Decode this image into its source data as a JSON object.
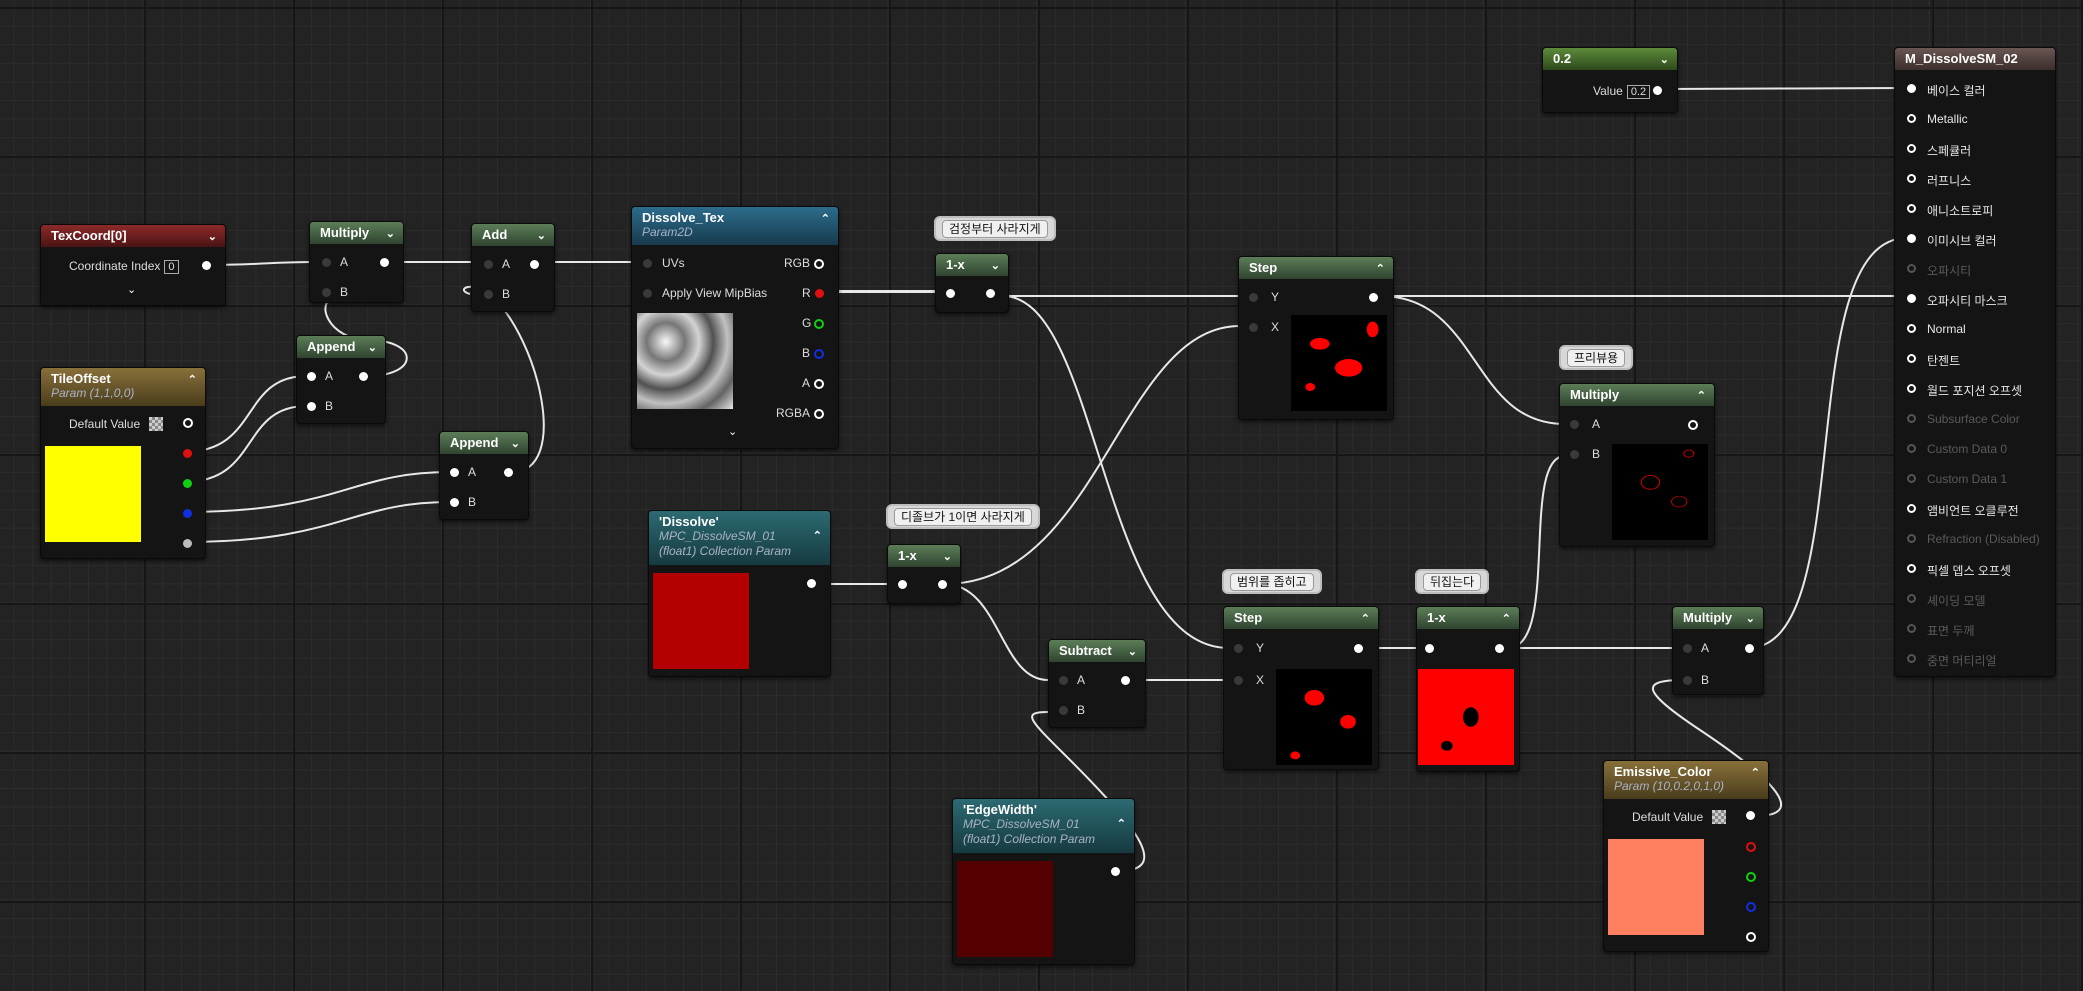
{
  "nodes": {
    "texcoord": {
      "title": "TexCoord[0]",
      "coord_label": "Coordinate Index",
      "coord_value": "0"
    },
    "tileoffset": {
      "title": "TileOffset",
      "subtitle": "Param (1,1,0,0)",
      "default_label": "Default Value",
      "swatch_color": "#ffff00"
    },
    "multiply1": {
      "title": "Multiply",
      "a": "A",
      "b": "B"
    },
    "append1": {
      "title": "Append",
      "a": "A",
      "b": "B"
    },
    "add": {
      "title": "Add",
      "a": "A",
      "b": "B"
    },
    "append2": {
      "title": "Append",
      "a": "A",
      "b": "B"
    },
    "dissolve_tex": {
      "title": "Dissolve_Tex",
      "subtitle": "Param2D",
      "uvs": "UVs",
      "mip": "Apply View MipBias",
      "rgb": "RGB",
      "r": "R",
      "g": "G",
      "b": "B",
      "a": "A",
      "rgba": "RGBA"
    },
    "dissolve_param": {
      "title": "'Dissolve'",
      "subtitle1": "MPC_DissolveSM_01",
      "subtitle2": "(float1) Collection Param",
      "swatch_color": "#b30000"
    },
    "oneminus1": {
      "title": "1-x"
    },
    "oneminus2": {
      "title": "1-x"
    },
    "oneminus3": {
      "title": "1-x"
    },
    "step1": {
      "title": "Step",
      "y": "Y",
      "x": "X"
    },
    "step2": {
      "title": "Step",
      "y": "Y",
      "x": "X"
    },
    "subtract": {
      "title": "Subtract",
      "a": "A",
      "b": "B"
    },
    "edgewidth": {
      "title": "'EdgeWidth'",
      "subtitle1": "MPC_DissolveSM_01",
      "subtitle2": "(float1) Collection Param",
      "swatch_color": "#550000"
    },
    "multiply2": {
      "title": "Multiply",
      "a": "A",
      "b": "B"
    },
    "multiply3": {
      "title": "Multiply",
      "a": "A",
      "b": "B"
    },
    "emissive": {
      "title": "Emissive_Color",
      "subtitle": "Param (10,0.2,0,1,0)",
      "default_label": "Default Value",
      "swatch_color": "#ff8060"
    },
    "const": {
      "title": "0.2",
      "value_label": "Value",
      "value": "0.2"
    }
  },
  "comments": {
    "c1": "검정부터 사라지게",
    "c2": "디졸브가 1이면 사라지게",
    "c3": "범위를 좁히고",
    "c4": "뒤집는다",
    "c5": "프리뷰용"
  },
  "material": {
    "title": "M_DissolveSM_02",
    "inputs": [
      {
        "label": "베이스 컬러",
        "state": "on"
      },
      {
        "label": "Metallic",
        "state": "hollow"
      },
      {
        "label": "스페큘러",
        "state": "hollow"
      },
      {
        "label": "러프니스",
        "state": "hollow"
      },
      {
        "label": "애니소트로피",
        "state": "hollow"
      },
      {
        "label": "이미시브 컬러",
        "state": "on"
      },
      {
        "label": "오파시티",
        "state": "off"
      },
      {
        "label": "오파시티 마스크",
        "state": "on"
      },
      {
        "label": "Normal",
        "state": "hollow"
      },
      {
        "label": "탄젠트",
        "state": "hollow"
      },
      {
        "label": "월드 포지션 오프셋",
        "state": "hollow"
      },
      {
        "label": "Subsurface Color",
        "state": "off"
      },
      {
        "label": "Custom Data 0",
        "state": "off"
      },
      {
        "label": "Custom Data 1",
        "state": "off"
      },
      {
        "label": "앰비언트 오클루전",
        "state": "hollow"
      },
      {
        "label": "Refraction (Disabled)",
        "state": "off"
      },
      {
        "label": "픽셀 뎁스 오프셋",
        "state": "hollow"
      },
      {
        "label": "셰이딩 모델",
        "state": "off"
      },
      {
        "label": "표면 두께",
        "state": "off"
      },
      {
        "label": "중면 머티리얼",
        "state": "off"
      }
    ]
  }
}
